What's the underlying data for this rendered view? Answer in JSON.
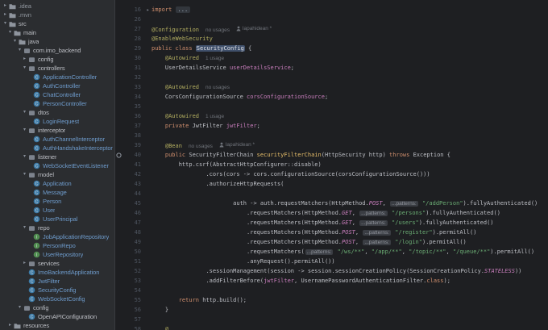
{
  "colors": {
    "panel_bg": "#2B2D30",
    "editor_bg": "#1E1F22",
    "default_text": "#BCBEC4",
    "keyword": "#CF8E6D",
    "annotation": "#B3AE60",
    "string": "#6AAB73",
    "constant": "#C77DBB",
    "field": "#C77DBB",
    "method": "#E8BF6A",
    "line_number": "#4E5560",
    "modified_file": "#6E9BCB",
    "hint": "#6F737A"
  },
  "project_tree": {
    "items": [
      {
        "label": ".idea",
        "depth": 0,
        "kind": "folder",
        "state": "collapsed",
        "dim": true
      },
      {
        "label": ".mvn",
        "depth": 0,
        "kind": "folder",
        "state": "collapsed",
        "dim": true
      },
      {
        "label": "src",
        "depth": 0,
        "kind": "folder",
        "state": "expanded"
      },
      {
        "label": "main",
        "depth": 1,
        "kind": "folder",
        "state": "expanded"
      },
      {
        "label": "java",
        "depth": 2,
        "kind": "folder",
        "state": "expanded"
      },
      {
        "label": "com.imo_backend",
        "depth": 3,
        "kind": "package",
        "state": "expanded"
      },
      {
        "label": "config",
        "depth": 4,
        "kind": "package",
        "state": "collapsed"
      },
      {
        "label": "controllers",
        "depth": 4,
        "kind": "package",
        "state": "expanded"
      },
      {
        "label": "ApplicationController",
        "depth": 5,
        "kind": "class"
      },
      {
        "label": "AuthController",
        "depth": 5,
        "kind": "class"
      },
      {
        "label": "ChatController",
        "depth": 5,
        "kind": "class"
      },
      {
        "label": "PersonController",
        "depth": 5,
        "kind": "class"
      },
      {
        "label": "dtos",
        "depth": 4,
        "kind": "package",
        "state": "expanded"
      },
      {
        "label": "LoginRequest",
        "depth": 5,
        "kind": "class"
      },
      {
        "label": "interceptor",
        "depth": 4,
        "kind": "package",
        "state": "expanded"
      },
      {
        "label": "AuthChannelInterceptor",
        "depth": 5,
        "kind": "class"
      },
      {
        "label": "AuthHandshakeInterceptor",
        "depth": 5,
        "kind": "class"
      },
      {
        "label": "listener",
        "depth": 4,
        "kind": "package",
        "state": "expanded"
      },
      {
        "label": "WebSocketEventListener",
        "depth": 5,
        "kind": "class"
      },
      {
        "label": "model",
        "depth": 4,
        "kind": "package",
        "state": "expanded"
      },
      {
        "label": "Application",
        "depth": 5,
        "kind": "class"
      },
      {
        "label": "Message",
        "depth": 5,
        "kind": "class"
      },
      {
        "label": "Person",
        "depth": 5,
        "kind": "class"
      },
      {
        "label": "User",
        "depth": 5,
        "kind": "class"
      },
      {
        "label": "UserPrincipal",
        "depth": 5,
        "kind": "class"
      },
      {
        "label": "repo",
        "depth": 4,
        "kind": "package",
        "state": "expanded"
      },
      {
        "label": "JobApplicationRepository",
        "depth": 5,
        "kind": "interface"
      },
      {
        "label": "PersonRepo",
        "depth": 5,
        "kind": "interface"
      },
      {
        "label": "UserRepository",
        "depth": 5,
        "kind": "interface"
      },
      {
        "label": "services",
        "depth": 4,
        "kind": "package",
        "state": "collapsed"
      },
      {
        "label": "ImoBackendApplication",
        "depth": 4,
        "kind": "class"
      },
      {
        "label": "JwtFilter",
        "depth": 4,
        "kind": "class"
      },
      {
        "label": "SecurityConfig",
        "depth": 4,
        "kind": "class"
      },
      {
        "label": "WebSocketConfig",
        "depth": 4,
        "kind": "class"
      },
      {
        "label": "config",
        "depth": 3,
        "kind": "package",
        "state": "expanded"
      },
      {
        "label": "OpenAPIConfiguration",
        "depth": 4,
        "kind": "class",
        "plain": true
      },
      {
        "label": "resources",
        "depth": 1,
        "kind": "folder",
        "state": "collapsed"
      }
    ]
  },
  "editor": {
    "lines": [
      {
        "num": "16",
        "fold": true,
        "tokens": [
          [
            "k",
            "import "
          ],
          [
            "fd",
            "..."
          ]
        ]
      },
      {
        "num": "26",
        "tokens": []
      },
      {
        "num": "27",
        "tokens": [
          [
            "a",
            "@Configuration"
          ],
          [
            "h",
            "no usages"
          ],
          [
            "u",
            "lapahidean *"
          ]
        ]
      },
      {
        "num": "28",
        "tokens": [
          [
            "a",
            "@EnableWebSecurity"
          ]
        ]
      },
      {
        "num": "29",
        "tokens": [
          [
            "k",
            "public class "
          ],
          [
            "hl",
            "SecurityConfig"
          ],
          [
            "d",
            " {"
          ]
        ]
      },
      {
        "num": "30",
        "ind": 4,
        "tokens": [
          [
            "a",
            "@Autowired"
          ],
          [
            "h",
            "1 usage"
          ]
        ]
      },
      {
        "num": "31",
        "ind": 4,
        "tokens": [
          [
            "d",
            "UserDetailsService "
          ],
          [
            "f",
            "userDetailsService"
          ],
          [
            "d",
            ";"
          ]
        ]
      },
      {
        "num": "32",
        "tokens": []
      },
      {
        "num": "33",
        "ind": 4,
        "tokens": [
          [
            "a",
            "@Autowired"
          ],
          [
            "h",
            "no usages"
          ]
        ]
      },
      {
        "num": "34",
        "ind": 4,
        "tokens": [
          [
            "d",
            "CorsConfigurationSource "
          ],
          [
            "f",
            "corsConfigurationSource"
          ],
          [
            "d",
            ";"
          ]
        ]
      },
      {
        "num": "35",
        "tokens": []
      },
      {
        "num": "36",
        "ind": 4,
        "tokens": [
          [
            "a",
            "@Autowired"
          ],
          [
            "h",
            "1 usage"
          ]
        ]
      },
      {
        "num": "37",
        "ind": 4,
        "tokens": [
          [
            "k",
            "private "
          ],
          [
            "d",
            "JwtFilter "
          ],
          [
            "f",
            "jwtFilter"
          ],
          [
            "d",
            ";"
          ]
        ]
      },
      {
        "num": "38",
        "tokens": []
      },
      {
        "num": "39",
        "ind": 4,
        "tokens": [
          [
            "a",
            "@Bean"
          ],
          [
            "h",
            "no usages"
          ],
          [
            "u",
            "lapahidean *"
          ]
        ]
      },
      {
        "num": "40",
        "ind": 4,
        "icon": "bean",
        "tokens": [
          [
            "k",
            "public "
          ],
          [
            "d",
            "SecurityFilterChain "
          ],
          [
            "m",
            "securityFilterChain"
          ],
          [
            "d",
            "(HttpSecurity http) "
          ],
          [
            "k",
            "throws "
          ],
          [
            "d",
            "Exception {"
          ]
        ]
      },
      {
        "num": "41",
        "ind": 8,
        "tokens": [
          [
            "d",
            "http.csrf(AbstractHttpConfigurer::disable)"
          ]
        ]
      },
      {
        "num": "42",
        "ind": 16,
        "tokens": [
          [
            "d",
            ".cors(cors -> cors.configurationSource(corsConfigurationSource()))"
          ]
        ]
      },
      {
        "num": "43",
        "ind": 16,
        "tokens": [
          [
            "d",
            ".authorizeHttpRequests("
          ]
        ]
      },
      {
        "num": "44",
        "tokens": []
      },
      {
        "num": "45",
        "ind": 24,
        "tokens": [
          [
            "d",
            "auth -> auth.requestMatchers(HttpMethod."
          ],
          [
            "c",
            "POST"
          ],
          [
            "d",
            ", "
          ],
          [
            "ch",
            "...patterns:"
          ],
          [
            "s",
            " \"/addPerson\""
          ],
          [
            "d",
            ").fullyAuthenticated()"
          ]
        ]
      },
      {
        "num": "46",
        "ind": 28,
        "tokens": [
          [
            "d",
            ".requestMatchers(HttpMethod."
          ],
          [
            "c",
            "GET"
          ],
          [
            "d",
            ", "
          ],
          [
            "ch",
            "...patterns:"
          ],
          [
            "s",
            " \"/persons\""
          ],
          [
            "d",
            ").fullyAuthenticated()"
          ]
        ]
      },
      {
        "num": "47",
        "ind": 28,
        "tokens": [
          [
            "d",
            ".requestMatchers(HttpMethod."
          ],
          [
            "c",
            "GET"
          ],
          [
            "d",
            ", "
          ],
          [
            "ch",
            "...patterns:"
          ],
          [
            "s",
            " \"/users\""
          ],
          [
            "d",
            ").fullyAuthenticated()"
          ]
        ]
      },
      {
        "num": "48",
        "ind": 28,
        "tokens": [
          [
            "d",
            ".requestMatchers(HttpMethod."
          ],
          [
            "c",
            "POST"
          ],
          [
            "d",
            ", "
          ],
          [
            "ch",
            "...patterns:"
          ],
          [
            "s",
            " \"/register\""
          ],
          [
            "d",
            ").permitAll()"
          ]
        ]
      },
      {
        "num": "49",
        "ind": 28,
        "tokens": [
          [
            "d",
            ".requestMatchers(HttpMethod."
          ],
          [
            "c",
            "POST"
          ],
          [
            "d",
            ", "
          ],
          [
            "ch",
            "...patterns:"
          ],
          [
            "s",
            " \"/login\""
          ],
          [
            "d",
            ").permitAll()"
          ]
        ]
      },
      {
        "num": "50",
        "ind": 28,
        "tokens": [
          [
            "d",
            ".requestMatchers("
          ],
          [
            "ch",
            "...patterns:"
          ],
          [
            "s",
            " \"/ws/**\""
          ],
          [
            "d",
            ", "
          ],
          [
            "s",
            "\"/app/**\""
          ],
          [
            "d",
            ", "
          ],
          [
            "s",
            "\"/topic/**\""
          ],
          [
            "d",
            ", "
          ],
          [
            "s",
            "\"/queue/**\""
          ],
          [
            "d",
            ").permitAll()"
          ]
        ]
      },
      {
        "num": "51",
        "ind": 28,
        "tokens": [
          [
            "d",
            ".anyRequest().permitAll())"
          ]
        ]
      },
      {
        "num": "52",
        "ind": 16,
        "tokens": [
          [
            "d",
            ".sessionManagement(session -> session.sessionCreationPolicy(SessionCreationPolicy."
          ],
          [
            "c",
            "STATELESS"
          ],
          [
            "d",
            "))"
          ]
        ]
      },
      {
        "num": "53",
        "ind": 16,
        "tokens": [
          [
            "d",
            ".addFilterBefore("
          ],
          [
            "f",
            "jwtFilter"
          ],
          [
            "d",
            ", UsernamePasswordAuthenticationFilter."
          ],
          [
            "k",
            "class"
          ],
          [
            "d",
            ");"
          ]
        ]
      },
      {
        "num": "54",
        "tokens": []
      },
      {
        "num": "55",
        "ind": 8,
        "tokens": [
          [
            "k",
            "return "
          ],
          [
            "d",
            "http.build();"
          ]
        ]
      },
      {
        "num": "56",
        "ind": 4,
        "tokens": [
          [
            "d",
            "}"
          ]
        ]
      },
      {
        "num": "57",
        "tokens": []
      },
      {
        "num": "58",
        "ind": 4,
        "tokens": [
          [
            "a",
            "@"
          ]
        ]
      }
    ]
  }
}
